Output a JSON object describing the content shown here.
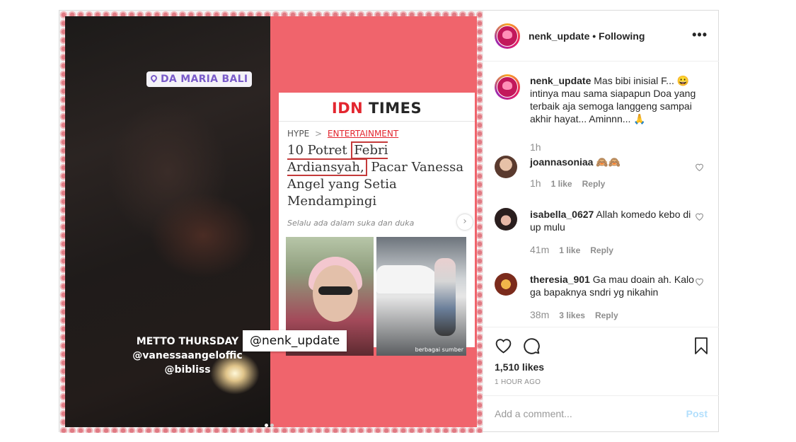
{
  "story": {
    "location": "DA MARIA BALI",
    "caption_lines": [
      "METTO THURSDAY",
      "@vanessaangeloffic",
      "@bibliss"
    ]
  },
  "article": {
    "brand_a": "IDN",
    "brand_b": " TIMES",
    "breadcrumb_home": "HYPE",
    "breadcrumb_sep": ">",
    "breadcrumb_cat": "ENTERTAINMENT",
    "headline_pre": "10 Potret ",
    "headline_hl": "Febri Ardiansyah,",
    "headline_post": " Pacar Vanessa Angel yang Setia Mendampingi",
    "subtitle": "Selalu ada dalam suka dan duka",
    "photo_source": "berbagai sumber"
  },
  "overlay_tag": "@nenk_update",
  "header": {
    "username": "nenk_update",
    "separator": " • ",
    "follow_state": "Following",
    "more_label": "•••"
  },
  "caption": {
    "username": "nenk_update",
    "text": "Mas bibi inisial F... 😀 intinya mau sama siapapun Doa yang terbaik aja semoga langgeng sampai akhir hayat... Aminnn... 🙏",
    "time": "1h"
  },
  "comments": [
    {
      "username": "joannasoniaa",
      "text": "🙈🙈",
      "time": "1h",
      "likes": "1 like",
      "reply": "Reply"
    },
    {
      "username": "isabella_0627",
      "text": "Allah komedo kebo di up mulu",
      "time": "41m",
      "likes": "1 like",
      "reply": "Reply"
    },
    {
      "username": "theresia_901",
      "text": "Ga mau doain ah. Kalo ga bapaknya sndri yg nikahin",
      "time": "38m",
      "likes": "3 likes",
      "reply": "Reply"
    }
  ],
  "likes": "1,510 likes",
  "posted": "1 HOUR AGO",
  "add_comment_placeholder": "Add a comment...",
  "post_label": "Post"
}
